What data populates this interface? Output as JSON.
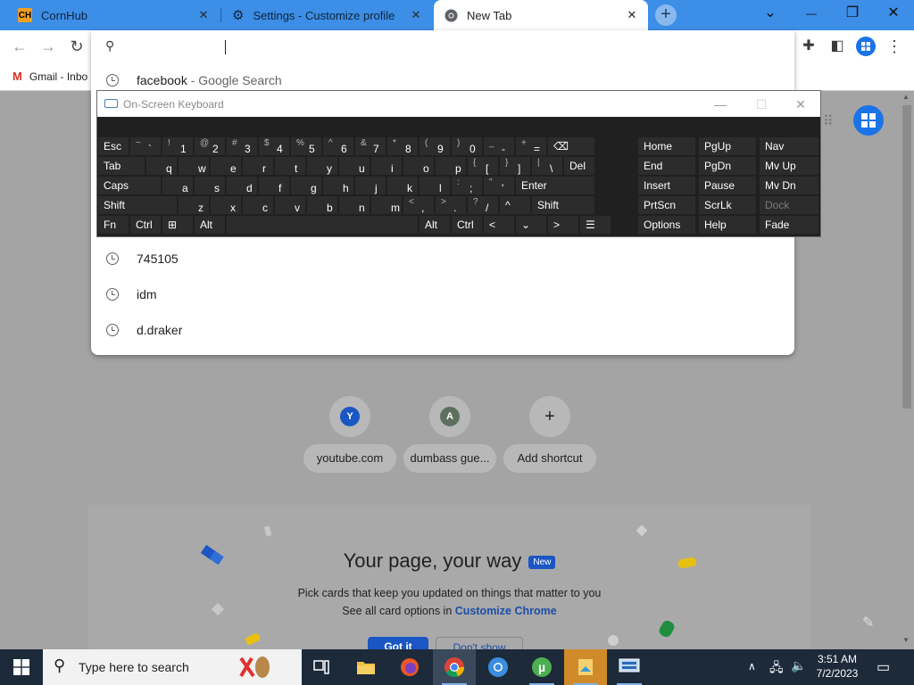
{
  "browser": {
    "tabs": [
      {
        "title": "CornHub",
        "favicon": "ch-favicon",
        "active": false
      },
      {
        "title": "Settings - Customize profile",
        "favicon": "gear-icon",
        "active": false
      },
      {
        "title": "New Tab",
        "favicon": "chrome-icon",
        "active": true
      }
    ],
    "new_tab_symbol": "+",
    "window_controls": {
      "tab_search": "⌄",
      "minimize": "—",
      "restore": "❐",
      "close": "✕"
    },
    "bookmark": {
      "label": "Gmail - Inbo"
    }
  },
  "omnibox": {
    "value": "",
    "suggestions": [
      {
        "text": "facebook",
        "suffix": "- Google Search"
      },
      {
        "text": "745105",
        "suffix": ""
      },
      {
        "text": "idm",
        "suffix": ""
      },
      {
        "text": "d.draker",
        "suffix": ""
      }
    ]
  },
  "osk": {
    "title": "On-Screen Keyboard",
    "rows": [
      [
        [
          "Esc",
          ""
        ],
        [
          "~",
          "`"
        ],
        [
          "!",
          "1"
        ],
        [
          "@",
          "2"
        ],
        [
          "#",
          "3"
        ],
        [
          "$",
          "4"
        ],
        [
          "%",
          "5"
        ],
        [
          "^",
          "6"
        ],
        [
          "&",
          "7"
        ],
        [
          "*",
          "8"
        ],
        [
          "(",
          "9"
        ],
        [
          ")",
          "0"
        ],
        [
          "_",
          "-"
        ],
        [
          "+",
          "="
        ],
        [
          "⌫",
          ""
        ]
      ],
      [
        [
          "Tab",
          ""
        ],
        [
          "",
          "q"
        ],
        [
          "",
          "w"
        ],
        [
          "",
          "e"
        ],
        [
          "",
          "r"
        ],
        [
          "",
          "t"
        ],
        [
          "",
          "y"
        ],
        [
          "",
          "u"
        ],
        [
          "",
          "i"
        ],
        [
          "",
          "o"
        ],
        [
          "",
          "p"
        ],
        [
          "{",
          "["
        ],
        [
          "}",
          "]"
        ],
        [
          "|",
          "\\"
        ],
        [
          "Del",
          ""
        ]
      ],
      [
        [
          "Caps",
          ""
        ],
        [
          "",
          "a"
        ],
        [
          "",
          "s"
        ],
        [
          "",
          "d"
        ],
        [
          "",
          "f"
        ],
        [
          "",
          "g"
        ],
        [
          "",
          "h"
        ],
        [
          "",
          "j"
        ],
        [
          "",
          "k"
        ],
        [
          "",
          "l"
        ],
        [
          ":",
          ";"
        ],
        [
          "\"",
          "'"
        ],
        [
          "Enter",
          ""
        ]
      ],
      [
        [
          "Shift",
          ""
        ],
        [
          "",
          "z"
        ],
        [
          "",
          "x"
        ],
        [
          "",
          "c"
        ],
        [
          "",
          "v"
        ],
        [
          "",
          "b"
        ],
        [
          "",
          "n"
        ],
        [
          "",
          "m"
        ],
        [
          "<",
          ","
        ],
        [
          ">",
          "."
        ],
        [
          "?",
          "/"
        ],
        [
          "^",
          ""
        ],
        [
          "Shift",
          ""
        ]
      ],
      [
        [
          "Fn",
          ""
        ],
        [
          "Ctrl",
          ""
        ],
        [
          "⊞",
          ""
        ],
        [
          "Alt",
          ""
        ],
        [
          "",
          ""
        ],
        [
          "Alt",
          ""
        ],
        [
          "Ctrl",
          ""
        ],
        [
          "<",
          ""
        ],
        [
          "⌄",
          ""
        ],
        [
          ">",
          ""
        ],
        [
          "☰",
          ""
        ]
      ]
    ],
    "nav_keys": [
      [
        "Home",
        "PgUp",
        "Nav"
      ],
      [
        "End",
        "PgDn",
        "Mv Up"
      ],
      [
        "Insert",
        "Pause",
        "Mv Dn"
      ],
      [
        "PrtScn",
        "ScrLk",
        "Dock"
      ],
      [
        "Options",
        "Help",
        "Fade"
      ]
    ]
  },
  "shortcuts": [
    {
      "letter": "Y",
      "label": "youtube.com",
      "color": "#1a56c4"
    },
    {
      "letter": "A",
      "label": "dumbass gue...",
      "color": "#5f6f5f"
    },
    {
      "letter": "+",
      "label": "Add shortcut",
      "color": ""
    }
  ],
  "card": {
    "title": "Your page, your way",
    "badge": "New",
    "line1": "Pick cards that keep you updated on things that matter to you",
    "line2_prefix": "See all card options in",
    "line2_link": "Customize Chrome",
    "btn_primary": "Got it",
    "btn_secondary": "Don't show"
  },
  "taskbar": {
    "search_placeholder": "Type here to search",
    "time": "3:51 AM",
    "date": "7/2/2023"
  }
}
